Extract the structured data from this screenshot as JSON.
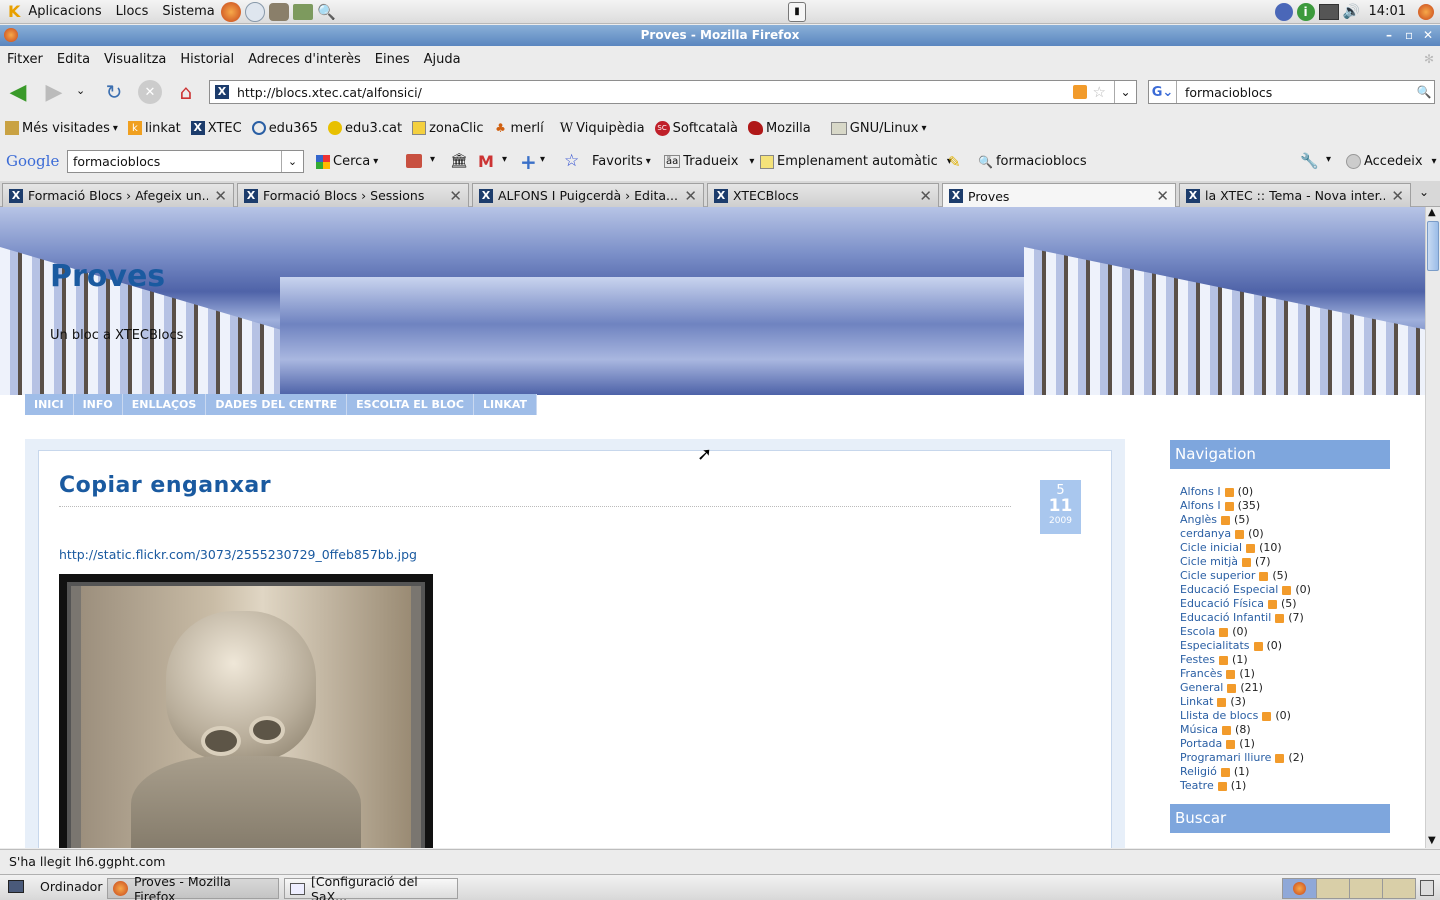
{
  "gnome_panel": {
    "menus": [
      "Aplicacions",
      "Llocs",
      "Sistema"
    ],
    "clock": "14:01"
  },
  "window": {
    "title": "Proves - Mozilla Firefox"
  },
  "menubar": [
    "Fitxer",
    "Edita",
    "Visualitza",
    "Historial",
    "Adreces d'interès",
    "Eines",
    "Ajuda"
  ],
  "navigation": {
    "url": "http://blocs.xtec.cat/alfonsici/",
    "search_value": "formacioblocs"
  },
  "bookmarks": [
    {
      "label": "Més visitades",
      "icon": "bookmark-icon"
    },
    {
      "label": "linkat",
      "icon": "linkat-icon"
    },
    {
      "label": "XTEC",
      "icon": "xtec-icon"
    },
    {
      "label": "edu365",
      "icon": "edu365-icon"
    },
    {
      "label": "edu3.cat",
      "icon": "edu3-icon"
    },
    {
      "label": "zonaClic",
      "icon": "zonaclic-icon"
    },
    {
      "label": "merlí",
      "icon": "merli-icon"
    },
    {
      "label": "Viquipèdia",
      "icon": "wikipedia-icon"
    },
    {
      "label": "Softcatalà",
      "icon": "softcatala-icon"
    },
    {
      "label": "Mozilla",
      "icon": "mozilla-icon"
    },
    {
      "label": "GNU/Linux",
      "icon": "folder-icon"
    }
  ],
  "google_toolbar": {
    "logo": "Google",
    "query": "formacioblocs",
    "search_btn": "Cerca",
    "favorites": "Favorits",
    "translate": "Tradueix",
    "autofill": "Emplenament automàtic",
    "term": "formacioblocs",
    "signin": "Accedeix"
  },
  "tabs": [
    {
      "label": "Formació Blocs › Afegeix un..."
    },
    {
      "label": "Formació Blocs › Sessions"
    },
    {
      "label": "ALFONS I Puigcerdà › Edita..."
    },
    {
      "label": "XTECBlocs"
    },
    {
      "label": "Proves"
    },
    {
      "label": "la XTEC :: Tema - Nova inter..."
    }
  ],
  "blog": {
    "title": "Proves",
    "tagline": "Un bloc a XTECBlocs",
    "nav": [
      "INICI",
      "INFO",
      "ENLLAÇOS",
      "DADES DEL CENTRE",
      "ESCOLTA EL BLOC",
      "LINKAT"
    ],
    "post": {
      "title": "Copiar enganxar",
      "date_day": "5",
      "date_month": "11",
      "date_year": "2009",
      "link": "http://static.flickr.com/3073/2555230729_0ffeb857bb.jpg"
    },
    "sidebar": {
      "nav_title": "Navigation",
      "search_title": "Buscar",
      "categories": [
        {
          "name": "Alfons I",
          "count": "(0)"
        },
        {
          "name": "Alfons I",
          "count": "(35)"
        },
        {
          "name": "Anglès",
          "count": "(5)"
        },
        {
          "name": "cerdanya",
          "count": "(0)"
        },
        {
          "name": "Cicle inicial",
          "count": "(10)"
        },
        {
          "name": "Cicle mitjà",
          "count": "(7)"
        },
        {
          "name": "Cicle superior",
          "count": "(5)"
        },
        {
          "name": "Educació Especial",
          "count": "(0)"
        },
        {
          "name": "Educació Física",
          "count": "(5)"
        },
        {
          "name": "Educació Infantil",
          "count": "(7)"
        },
        {
          "name": "Escola",
          "count": "(0)"
        },
        {
          "name": "Especialitats",
          "count": "(0)"
        },
        {
          "name": "Festes",
          "count": "(1)"
        },
        {
          "name": "Francès",
          "count": "(1)"
        },
        {
          "name": "General",
          "count": "(21)"
        },
        {
          "name": "Linkat",
          "count": "(3)"
        },
        {
          "name": "Llista de blocs",
          "count": "(0)"
        },
        {
          "name": "Música",
          "count": "(8)"
        },
        {
          "name": "Portada",
          "count": "(1)"
        },
        {
          "name": "Programari lliure",
          "count": "(2)"
        },
        {
          "name": "Religió",
          "count": "(1)"
        },
        {
          "name": "Teatre",
          "count": "(1)"
        }
      ]
    }
  },
  "status": "S'ha llegit lh6.ggpht.com",
  "taskbar": {
    "desktop": "Ordinador",
    "tasks": [
      "Proves - Mozilla Firefox",
      "[Configuració del SaX..."
    ]
  },
  "colors": {
    "accent": "#7ea6dd",
    "link": "#2a5fa4",
    "titlebar": "#5a86bf"
  }
}
